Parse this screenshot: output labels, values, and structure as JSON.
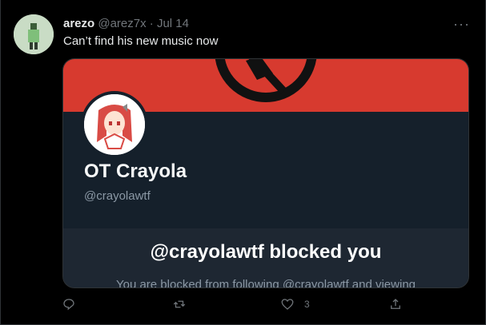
{
  "tweet": {
    "name": "arezo",
    "handle": "@arez7x",
    "separator": "·",
    "date": "Jul 14",
    "text": "Can’t find his new music now"
  },
  "card": {
    "display_name": "OT Crayola",
    "handle": "@crayolawtf",
    "blocked_title": "@crayolawtf blocked you",
    "blocked_description": "You are blocked from following @crayolawtf and viewing"
  },
  "actions": {
    "like_count": "3"
  },
  "colors": {
    "banner": "#d73a2f",
    "card_bg": "#15202b"
  }
}
